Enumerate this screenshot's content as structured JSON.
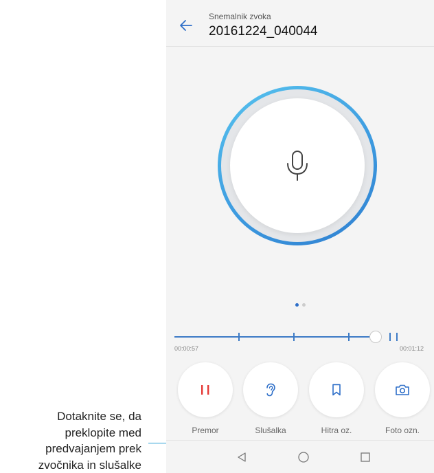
{
  "annotation": {
    "lines": [
      "Dotaknite se, da",
      "preklopite med",
      "predvajanjem prek",
      "zvočnika in slušalke"
    ]
  },
  "app": {
    "subtitle": "Snemalnik zvoka",
    "title": "20161224_040044"
  },
  "mic": {
    "icon": "microphone-icon"
  },
  "pager": {
    "active_index": 0,
    "count": 2
  },
  "playback": {
    "current_time": "00:00:57",
    "total_time": "00:01:12"
  },
  "actions": [
    {
      "label": "Premor",
      "icon": "pause-icon",
      "color": "#e53935"
    },
    {
      "label": "Slušalka",
      "icon": "ear-icon",
      "color": "#2d6ec8"
    },
    {
      "label": "Hitra oz.",
      "icon": "bookmark-icon",
      "color": "#2d6ec8"
    },
    {
      "label": "Foto ozn.",
      "icon": "camera-icon",
      "color": "#2d6ec8"
    }
  ],
  "nav": {
    "back_icon": "nav-back-icon",
    "home_icon": "nav-home-icon",
    "recents_icon": "nav-recents-icon"
  },
  "colors": {
    "accent": "#2d6ec8",
    "ring_start": "#57c3ee",
    "ring_end": "#2f7fd0",
    "pause_red": "#e53935",
    "callout_line": "#2a9fd6"
  }
}
